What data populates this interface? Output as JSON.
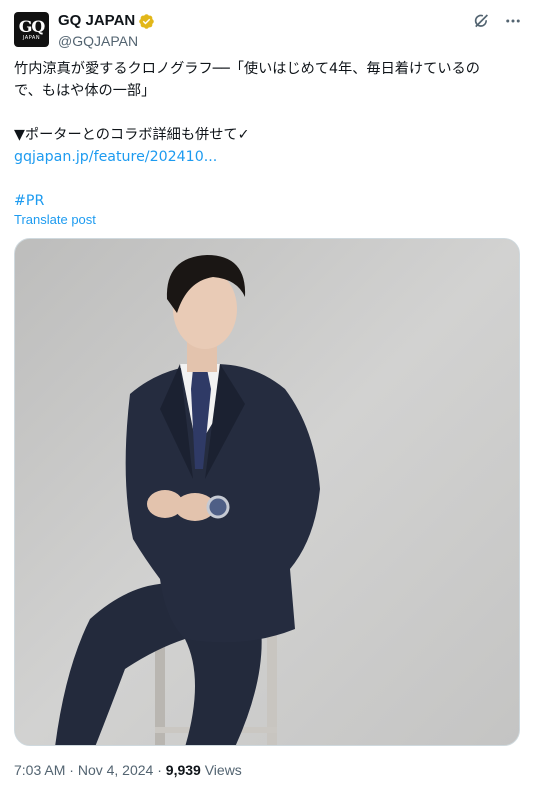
{
  "account": {
    "avatar_text_top": "GQ",
    "avatar_text_bottom": "JAPAN",
    "display_name": "GQ JAPAN",
    "handle": "@GQJAPAN"
  },
  "icons": {
    "verified": "verified-badge-icon",
    "grok": "grok-icon",
    "more": "more-icon"
  },
  "tweet": {
    "line1": "竹内涼真が愛するクロノグラフ──「使いはじめて4年、毎日着けているの",
    "line2": "で、もはや体の一部」",
    "line3": "▼ポーターとのコラボ詳細も併せて✓",
    "link": "gqjapan.jp/feature/202410...",
    "hashtag": "#PR",
    "translate": "Translate post"
  },
  "footer": {
    "time": "7:03 AM",
    "date": "Nov 4, 2024",
    "views_count": "9,939",
    "views_label": "Views",
    "sep": "·"
  },
  "colors": {
    "accent": "#1d9bf0",
    "verified": "#e2b719",
    "text": "#0f1419",
    "secondary": "#536471"
  }
}
